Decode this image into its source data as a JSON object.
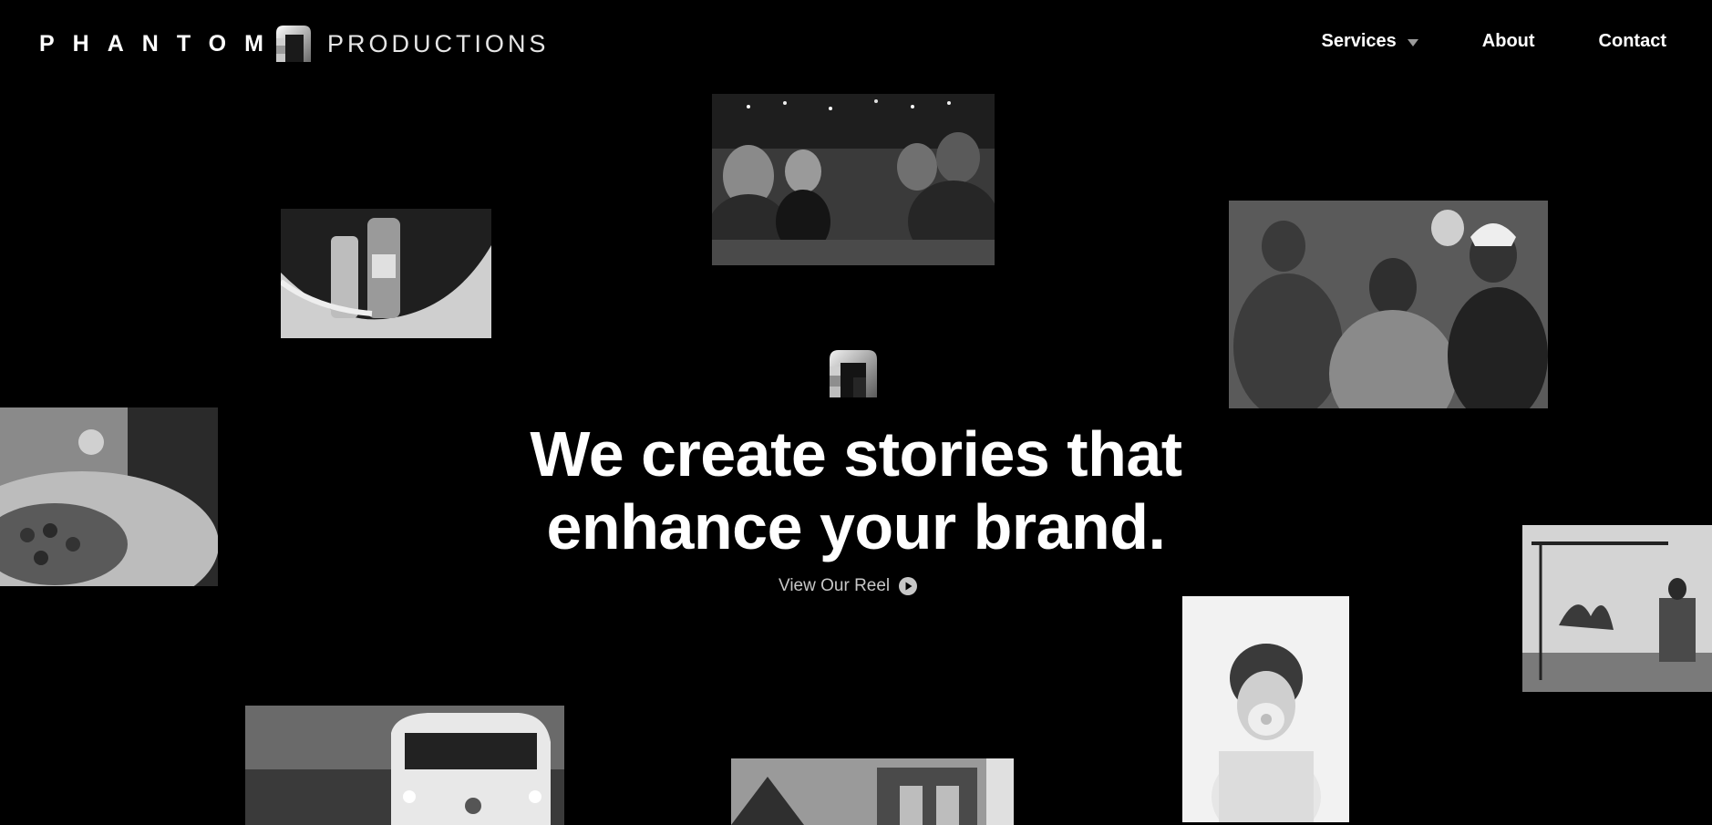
{
  "brand": {
    "name_left": "PHANTOM",
    "name_right": "PRODUCTIONS",
    "mark_icon": "phantom-block-logo-icon"
  },
  "nav": {
    "items": [
      {
        "label": "Services",
        "has_dropdown": true,
        "icon": "caret-down-icon"
      },
      {
        "label": "About",
        "has_dropdown": false
      },
      {
        "label": "Contact",
        "has_dropdown": false
      }
    ]
  },
  "hero": {
    "mark_icon": "phantom-block-logo-icon",
    "heading_line1": "We create stories that",
    "heading_line2": "enhance your brand.",
    "cta_label": "View Our Reel",
    "cta_icon": "play-circle-icon"
  },
  "colors": {
    "background": "#000000",
    "text": "#ffffff",
    "muted_text": "#c7c7c7",
    "caret": "#9a9a9a"
  }
}
